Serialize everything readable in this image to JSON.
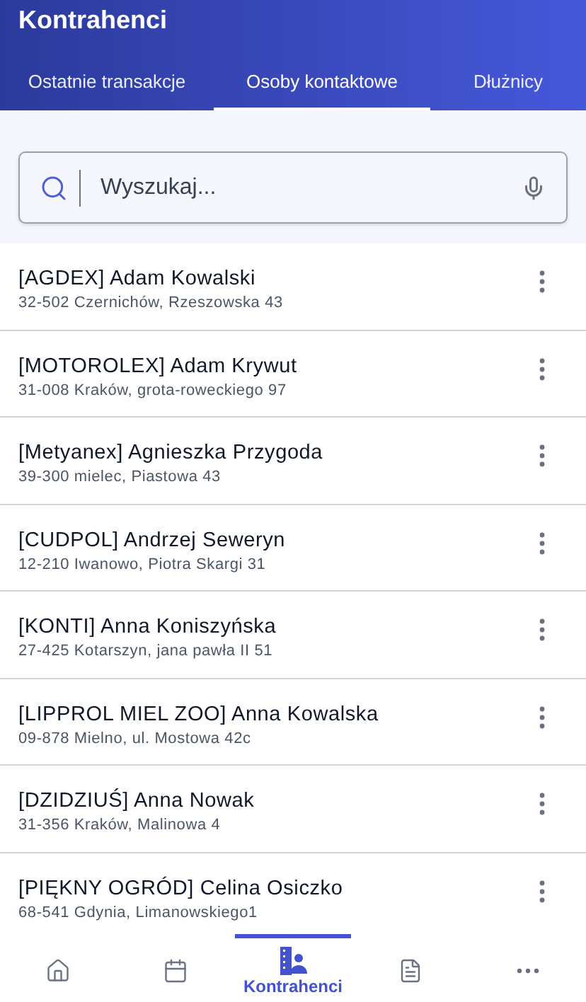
{
  "app_bar": {
    "title": "Kontrahenci"
  },
  "tabs": [
    {
      "label": "Ostatnie transakcje",
      "selected": false
    },
    {
      "label": "Osoby kontaktowe",
      "selected": true
    },
    {
      "label": "Dłużnicy",
      "selected": false
    }
  ],
  "search": {
    "placeholder": "Wyszukaj..."
  },
  "contacts": [
    {
      "name": "[AGDEX] Adam Kowalski",
      "address": "32-502 Czernichów, Rzeszowska 43"
    },
    {
      "name": "[MOTOROLEX] Adam Krywut",
      "address": "31-008 Kraków, grota-roweckiego 97"
    },
    {
      "name": "[Metyanex] Agnieszka Przygoda",
      "address": "39-300 mielec, Piastowa 43"
    },
    {
      "name": "[CUDPOL] Andrzej Seweryn",
      "address": "12-210 Iwanowo, Piotra Skargi 31"
    },
    {
      "name": "[KONTI] Anna Koniszyńska",
      "address": "27-425 Kotarszyn, jana pawła II 51"
    },
    {
      "name": "[LIPPROL MIEL ZOO] Anna Kowalska",
      "address": "09-878 Mielno, ul. Mostowa 42c"
    },
    {
      "name": "[DZIDZIUŚ] Anna Nowak",
      "address": "31-356 Kraków, Malinowa 4"
    },
    {
      "name": "[PIĘKNY OGRÓD] Celina Osiczko",
      "address": "68-541 Gdynia, Limanowskiego1"
    }
  ],
  "bottom_nav": [
    {
      "kind": "home",
      "selected": false
    },
    {
      "kind": "calendar",
      "selected": false
    },
    {
      "kind": "contractors",
      "selected": true,
      "label": "Kontrahenci"
    },
    {
      "kind": "document",
      "selected": false
    },
    {
      "kind": "more",
      "selected": false
    }
  ]
}
